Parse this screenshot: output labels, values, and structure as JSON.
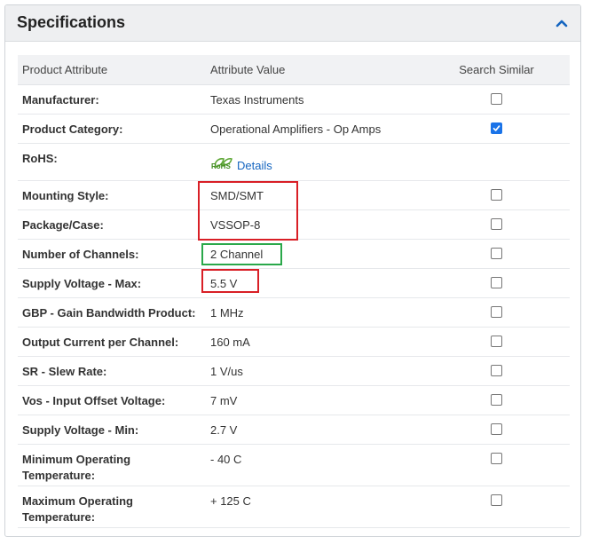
{
  "panel": {
    "title": "Specifications",
    "collapse_icon": "chevron-up-icon"
  },
  "colors": {
    "link": "#1565c0",
    "checkbox_checked": "#1a73e8",
    "highlight_red": "#d91f26",
    "highlight_green": "#2aa84a"
  },
  "table": {
    "headers": {
      "attribute": "Product Attribute",
      "value": "Attribute Value",
      "search": "Search Similar"
    },
    "rows": [
      {
        "attribute": "Manufacturer:",
        "value": "Texas Instruments",
        "checked": false
      },
      {
        "attribute": "Product Category:",
        "value": "Operational Amplifiers - Op Amps",
        "checked": true
      },
      {
        "attribute": "RoHS:",
        "logo_text": "RoHS",
        "link": "Details"
      },
      {
        "attribute": "Mounting Style:",
        "value": "SMD/SMT",
        "checked": false
      },
      {
        "attribute": "Package/Case:",
        "value": "VSSOP-8",
        "checked": false
      },
      {
        "attribute": "Number of Channels:",
        "value": "2 Channel",
        "checked": false
      },
      {
        "attribute": "Supply Voltage - Max:",
        "value": "5.5 V",
        "checked": false
      },
      {
        "attribute": "GBP - Gain Bandwidth Product:",
        "value": "1 MHz",
        "checked": false
      },
      {
        "attribute": "Output Current per Channel:",
        "value": "160 mA",
        "checked": false
      },
      {
        "attribute": "SR - Slew Rate:",
        "value": "1 V/us",
        "checked": false
      },
      {
        "attribute": "Vos - Input Offset Voltage:",
        "value": "7 mV",
        "checked": false
      },
      {
        "attribute": "Supply Voltage - Min:",
        "value": "2.7 V",
        "checked": false
      },
      {
        "attribute": "Minimum Operating Temperature:",
        "value": "- 40 C",
        "checked": false
      },
      {
        "attribute": "Maximum Operating Temperature:",
        "value": "+ 125 C",
        "checked": false
      }
    ]
  }
}
